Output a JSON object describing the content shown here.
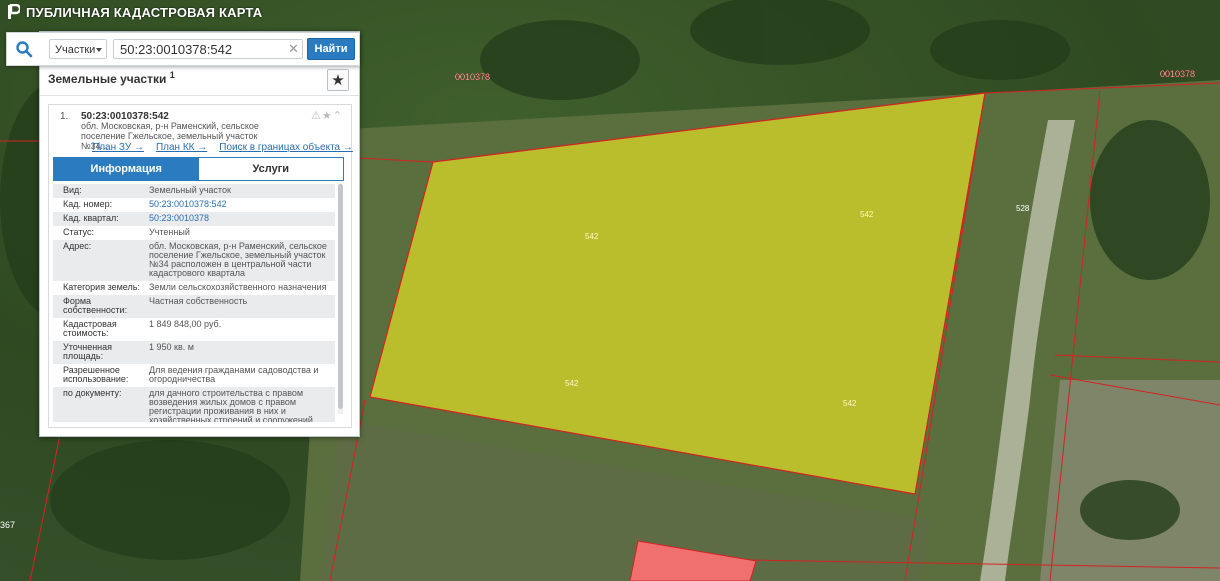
{
  "app": {
    "title": "ПУБЛИЧНАЯ КАДАСТРОВАЯ КАРТА"
  },
  "search": {
    "type_label": "Участки",
    "value": "50:23:0010378:542",
    "button_label": "Найти"
  },
  "section": {
    "title": "Земельные участки",
    "count": "1"
  },
  "result": {
    "index": "1.",
    "cad_number": "50:23:0010378:542",
    "address_short": "обл. Московская, р-н Раменский, сельское поселение Гжельское, земельный участок №34...",
    "links": [
      "План ЗУ →",
      "План КК →",
      "Поиск в границах объекта →"
    ]
  },
  "tabs": [
    "Информация",
    "Услуги"
  ],
  "info": [
    {
      "label": "Вид:",
      "value": "Земельный участок"
    },
    {
      "label": "Кад. номер:",
      "value": "50:23:0010378:542"
    },
    {
      "label": "Кад. квартал:",
      "value": "50:23:0010378"
    },
    {
      "label": "Статус:",
      "value": "Учтенный"
    },
    {
      "label": "Адрес:",
      "value": "обл. Московская, р-н Раменский, сельское поселение Гжельское, земельный участок №34 расположен в центральной части кадастрового квартала"
    },
    {
      "label": "Категория земель:",
      "value": "Земли сельскохозяйственного назначения"
    },
    {
      "label": "Форма собственности:",
      "value": "Частная собственность"
    },
    {
      "label": "Кадастровая стоимость:",
      "value": "1 849 848,00 руб."
    },
    {
      "label": "Уточненная площадь:",
      "value": "1 950 кв. м"
    },
    {
      "label": "Разрешенное использование:",
      "value": "Для ведения гражданами садоводства и огородничества"
    },
    {
      "label": "по документу:",
      "value": "для дачного строительства с правом возведения жилых домов с правом регистрации проживания в них и хозяйственных строений и сооружений"
    }
  ],
  "map_labels": {
    "quarter_left": "0010378",
    "quarter_right": "0010378",
    "parcel": "542",
    "neighbor": "528",
    "edge": "367"
  },
  "colors": {
    "parcel_fill": "#cfcf2a",
    "parcel_border": "#d62222",
    "accent": "#2a7bc0",
    "neighbor_fill": "#f07070"
  }
}
